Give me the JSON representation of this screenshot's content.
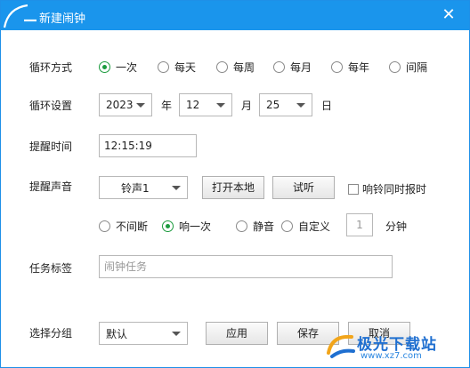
{
  "window": {
    "title": "新建闹钟",
    "close_glyph": "✕"
  },
  "loop_mode": {
    "label": "循环方式",
    "options": [
      "一次",
      "每天",
      "每周",
      "每月",
      "每年",
      "间隔"
    ],
    "selected": "一次"
  },
  "loop_settings": {
    "label": "循环设置",
    "year": {
      "value": "2023",
      "unit": "年"
    },
    "month": {
      "value": "12",
      "unit": "月"
    },
    "day": {
      "value": "25",
      "unit": "日"
    }
  },
  "remind_time": {
    "label": "提醒时间",
    "value": "12:15:19"
  },
  "remind_sound": {
    "label": "提醒声音",
    "ringtone": "铃声1",
    "open_local_label": "打开本地",
    "test_label": "试听",
    "report_time_label": "响铃同时报时",
    "report_time_checked": false,
    "repeat_options": [
      "不间断",
      "响一次",
      "静音",
      "自定义"
    ],
    "repeat_selected": "响一次",
    "custom_minutes": "1",
    "minutes_unit": "分钟"
  },
  "task_label": {
    "label": "任务标签",
    "placeholder": "闹钟任务"
  },
  "group": {
    "label": "选择分组",
    "value": "默认",
    "apply_label": "应用",
    "save_label": "保存",
    "cancel_label": "取消"
  },
  "watermark": {
    "text": "极光下载站",
    "url": "www.xz7.com"
  },
  "colors": {
    "titlebar": "#1a95ec",
    "radio_selected": "#1c9b3e"
  }
}
